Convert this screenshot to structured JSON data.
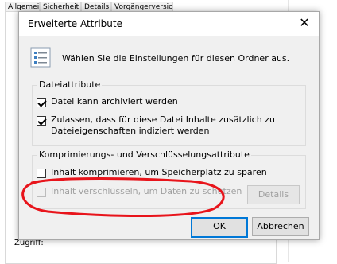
{
  "background": {
    "tabs": [
      "Allgemein",
      "Sicherheit",
      "Details",
      "Vorgängerversionen"
    ],
    "zugriff_label": "Zugriff:"
  },
  "dialog": {
    "title": "Erweiterte Attribute",
    "close_glyph": "✕",
    "intro_text": "Wählen Sie die Einstellungen für diesen Ordner aus.",
    "file_attributes": {
      "group_label": "Dateiattribute",
      "archive_label": "Datei kann archiviert werden",
      "archive_checked": true,
      "index_label_line1": "Zulassen, dass für diese Datei Inhalte zusätzlich zu",
      "index_label_line2": "Dateieigenschaften indiziert werden",
      "index_checked": true
    },
    "compress_encrypt": {
      "group_label": "Komprimierungs- und Verschlüsselungsattribute",
      "compress_label": "Inhalt komprimieren, um Speicherplatz zu sparen",
      "compress_checked": false,
      "encrypt_label": "Inhalt verschlüsseln, um Daten zu schützen",
      "encrypt_checked": false,
      "encrypt_disabled": true,
      "details_label": "Details"
    },
    "ok_label": "OK",
    "cancel_label": "Abbrechen"
  },
  "colors": {
    "annotation_red": "#e8141b",
    "focus_blue": "#0078d7"
  },
  "icons": {
    "info_icon": "attributes-list-icon",
    "close_icon": "close-icon"
  }
}
